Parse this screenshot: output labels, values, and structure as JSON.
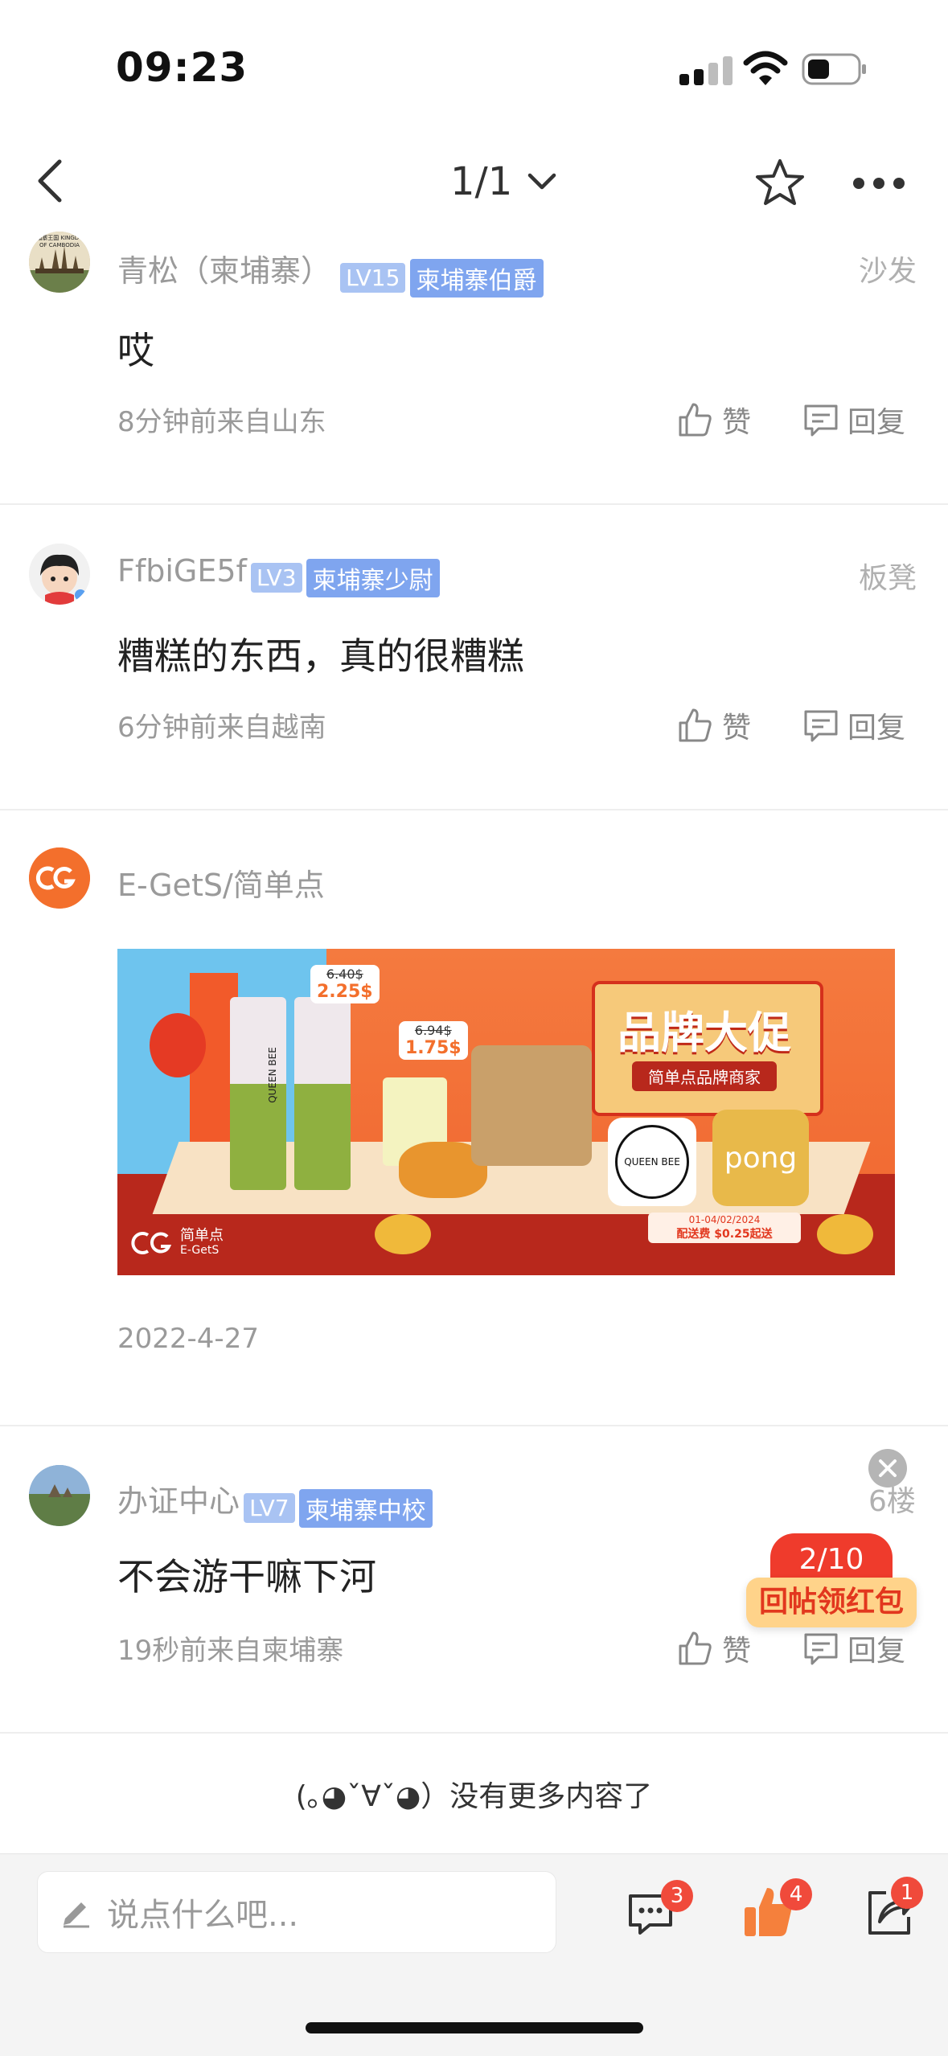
{
  "status_bar": {
    "time": "09:23"
  },
  "nav": {
    "pager": "1/1"
  },
  "comments": [
    {
      "username": "青松（柬埔寨）",
      "level": "LV15",
      "title_badge": "柬埔寨伯爵",
      "floor": "沙发",
      "content": "哎",
      "meta": "8分钟前来自山东",
      "like_label": "赞",
      "reply_label": "回复",
      "avatar_text": "柬埔寨王国 KINGDOM OF CAMBODIA"
    },
    {
      "username": "FfbiGE5f",
      "level": "LV3",
      "title_badge": "柬埔寨少尉",
      "floor": "板凳",
      "content": "糟糕的东西，真的很糟糕",
      "meta": "6分钟前来自越南",
      "like_label": "赞",
      "reply_label": "回复"
    },
    {
      "username": "办证中心",
      "level": "LV7",
      "title_badge": "柬埔寨中校",
      "floor": "6楼",
      "content": "不会游干嘛下河",
      "meta": "19秒前来自柬埔寨",
      "like_label": "赞",
      "reply_label": "回复"
    }
  ],
  "ad": {
    "username": "E-GetS/简单点",
    "date": "2022-4-27",
    "banner": {
      "headline": "品牌大促",
      "subheadline": "简单点品牌商家",
      "price_1_old": "6.40$",
      "price_1_new": "2.25$",
      "price_2_old": "6.94$",
      "price_2_new": "1.75$",
      "promo_date": "01-04/02/2024",
      "promo_fee": "配送费 $0.25起送",
      "logo_cn": "简单点",
      "logo_en": "E-GetS",
      "brand_1": "QUEEN BEE",
      "brand_2": "pong",
      "cup_text": "QUEEN BEE"
    }
  },
  "red_packet": {
    "counter": "2/10",
    "label": "回帖领红包"
  },
  "footer": {
    "no_more": "(｡◕ˇ∀ˇ◕）没有更多内容了"
  },
  "bottom_bar": {
    "input_placeholder": "说点什么吧...",
    "comment_count": "3",
    "like_count": "4",
    "share_count": "1"
  },
  "colors": {
    "accent_orange": "#f36f2c",
    "badge_red": "#f04a3b",
    "level_badge": "#a9c3f3",
    "title_badge": "#7fa5ef",
    "like_orange": "#f5803c"
  }
}
